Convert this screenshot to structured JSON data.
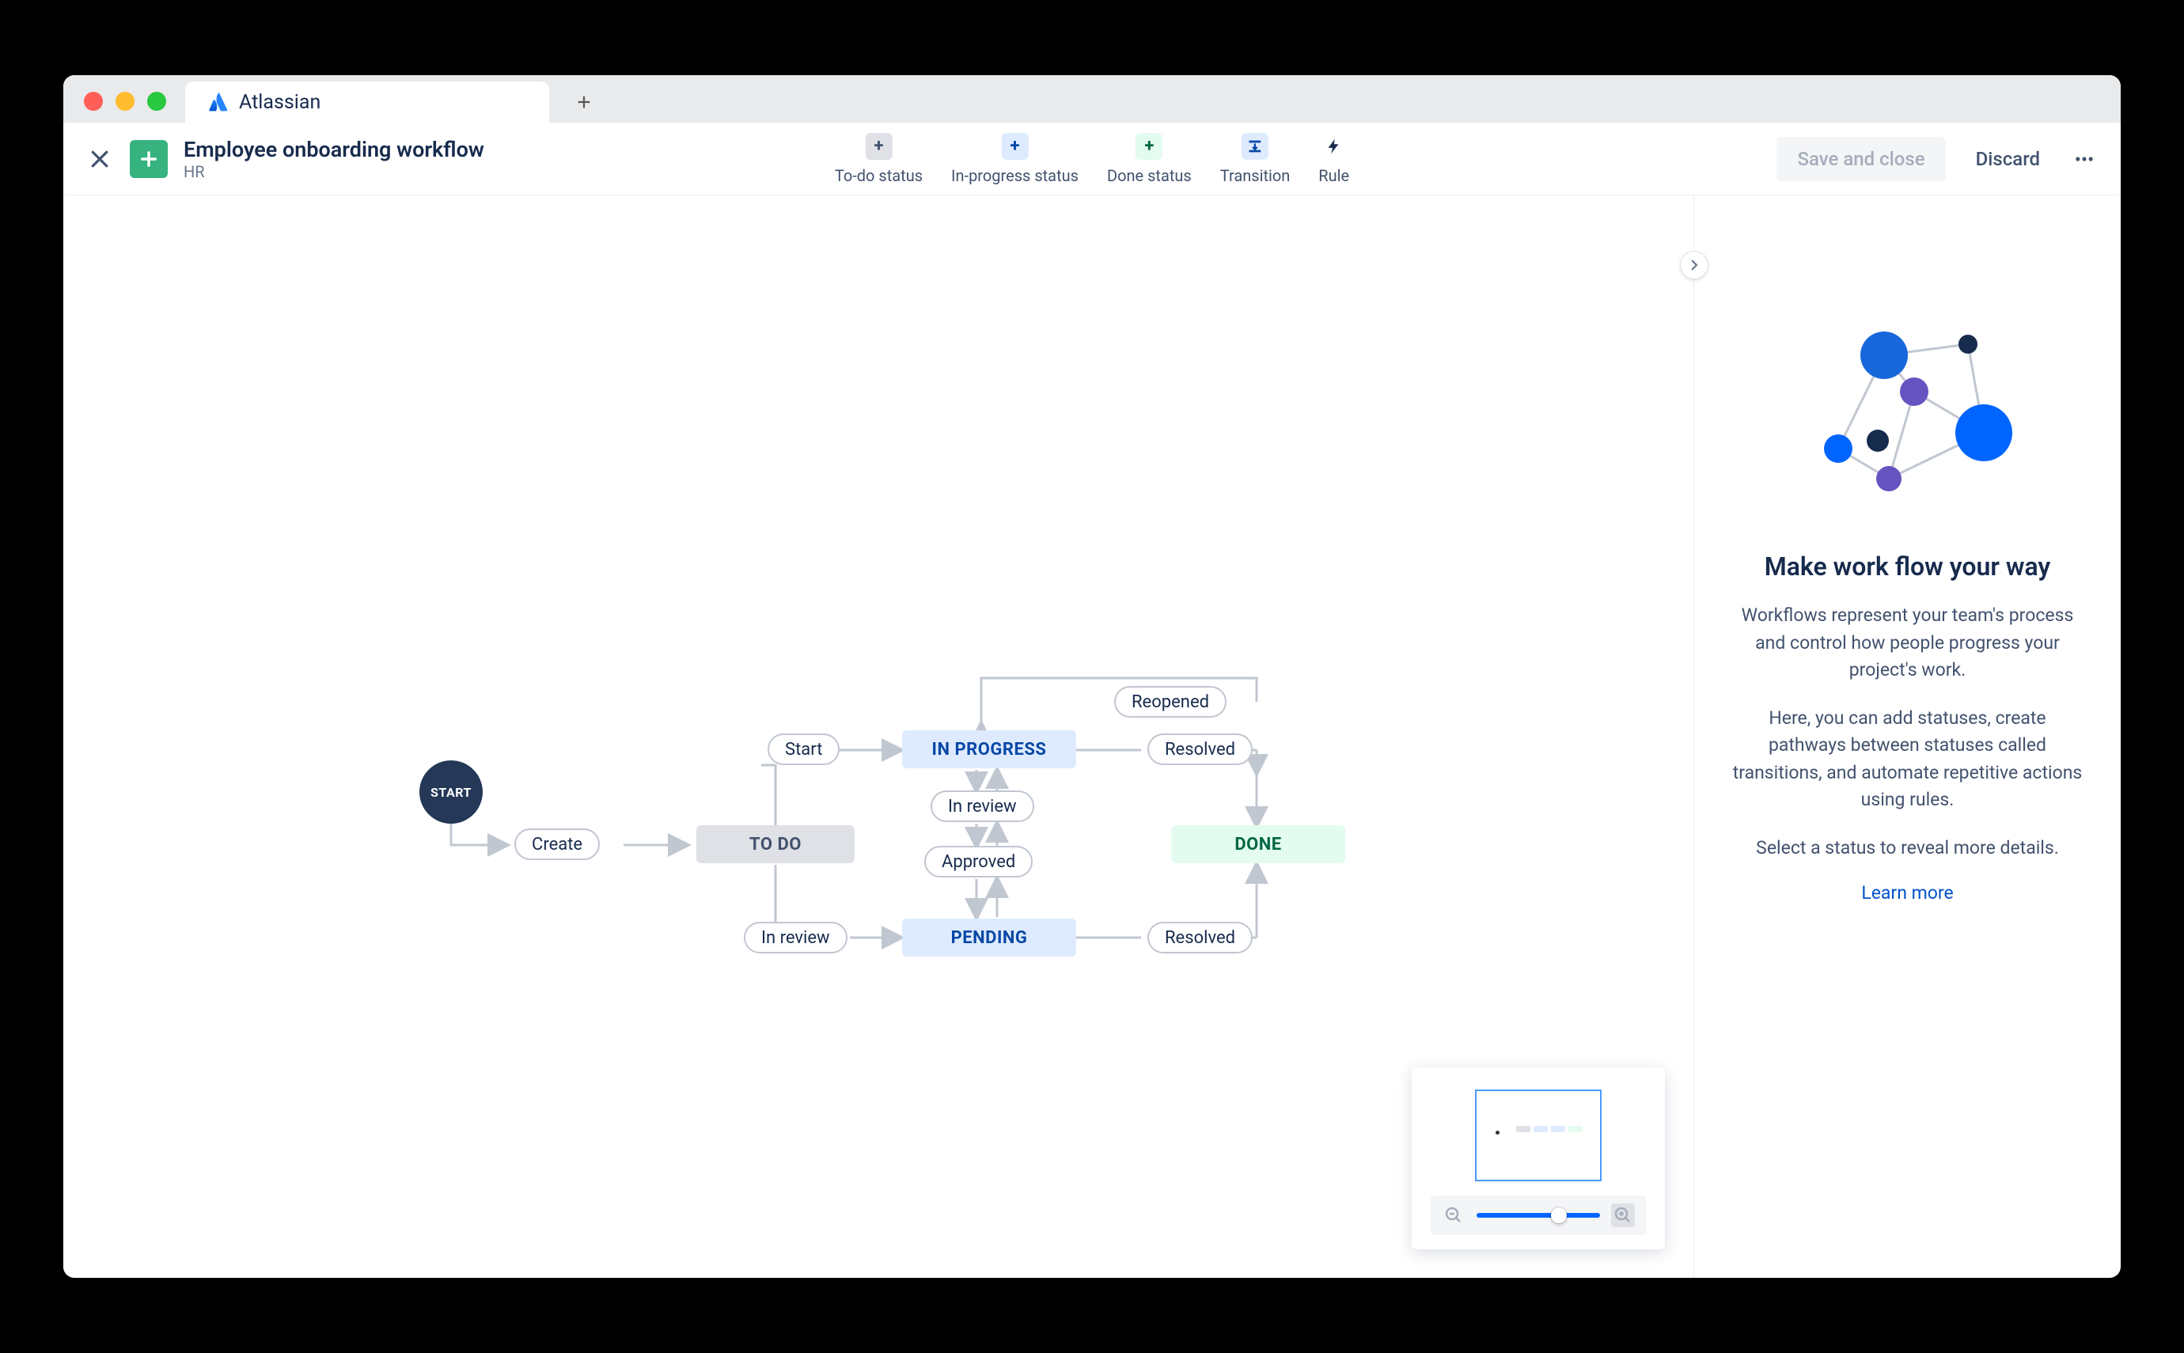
{
  "browser": {
    "tab_title": "Atlassian"
  },
  "header": {
    "workflow_title": "Employee onboarding workflow",
    "workflow_project": "HR",
    "toolbar": {
      "todo": "To-do status",
      "inprogress": "In-progress status",
      "done": "Done status",
      "transition": "Transition",
      "rule": "Rule"
    },
    "save": "Save and close",
    "discard": "Discard"
  },
  "canvas": {
    "start": "START",
    "statuses": {
      "todo": "TO DO",
      "inprogress": "IN PROGRESS",
      "pending": "PENDING",
      "done": "DONE"
    },
    "transitions": {
      "create": "Create",
      "start": "Start",
      "inreview_top": "In review",
      "approved": "Approved",
      "inreview_bottom": "In review",
      "reopened": "Reopened",
      "resolved_top": "Resolved",
      "resolved_bottom": "Resolved"
    }
  },
  "panel": {
    "title": "Make work flow your way",
    "p1": "Workflows represent your team's process and control how people progress your project's work.",
    "p2": "Here, you can add statuses, create pathways between statuses called transitions, and automate repetitive actions using rules.",
    "p3": "Select a status to reveal more details.",
    "link": "Learn more"
  },
  "colors": {
    "blue": "#0052cc",
    "green": "#36b37e",
    "navy": "#253858"
  }
}
